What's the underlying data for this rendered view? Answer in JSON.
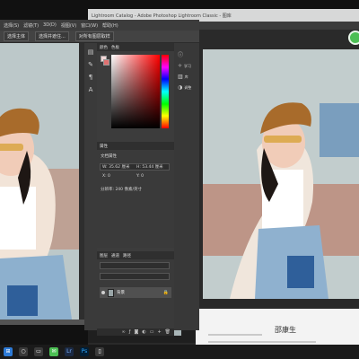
{
  "lightroom": {
    "title": "Lightroom Catalog - Adobe Photoshop Lightroom Classic - 图库",
    "status_name": "邵康生"
  },
  "photoshop": {
    "menu": [
      "选择(S)",
      "滤镜(T)",
      "3D(D)",
      "视图(V)",
      "窗口(W)",
      "帮助(H)"
    ],
    "options": [
      "选择主体",
      "选择并遮住...",
      "对所有图层取样"
    ],
    "color_panel_tabs": [
      "颜色",
      "色板"
    ],
    "properties": {
      "tab": "属性",
      "subtitle": "文档属性",
      "width": "W: 35.62 厘米",
      "height": "H: 53.44 厘米",
      "x": "X: 0",
      "y": "Y: 0",
      "resolution": "分辨率: 240 像素/英寸"
    },
    "layers": {
      "tabs": [
        "图层",
        "通道",
        "路径"
      ],
      "layer_name": "背景"
    },
    "dock": [
      {
        "icon": "info-icon",
        "label": ""
      },
      {
        "icon": "lightbulb-icon",
        "label": "学习"
      },
      {
        "icon": "library-icon",
        "label": "库"
      },
      {
        "icon": "adjust-icon",
        "label": "调整"
      }
    ]
  },
  "taskbar": {
    "icons": [
      "windows-icon",
      "search-icon",
      "chat-icon",
      "wechat-icon",
      "lightroom-icon",
      "photoshop-icon",
      "file-icon"
    ]
  },
  "colors": {
    "ps_panel": "#535353",
    "ps_dark": "#3c3c3c",
    "lr_window": "#2a2a2a",
    "wechat_green": "#4cbf54"
  }
}
